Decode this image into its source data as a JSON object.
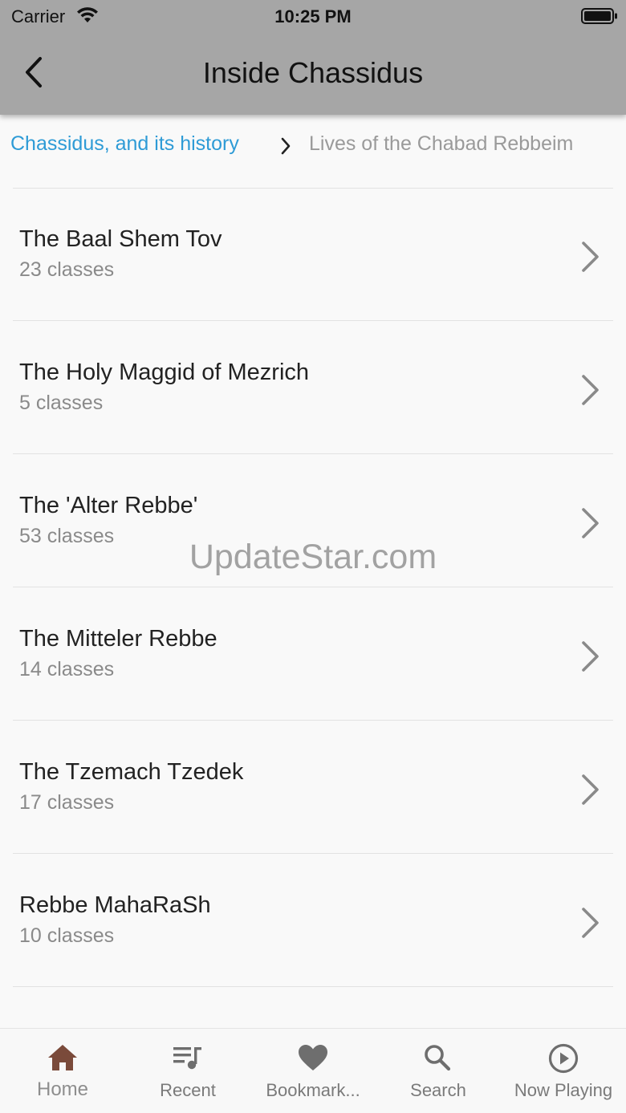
{
  "status_bar": {
    "carrier": "Carrier",
    "time": "10:25 PM"
  },
  "app_bar": {
    "title": "Inside Chassidus",
    "back_icon": "chevron-left-icon"
  },
  "breadcrumb": {
    "parent": "Chassidus, and its history",
    "separator_icon": "chevron-right-icon",
    "current": "Lives of the Chabad Rebbeim"
  },
  "list": {
    "items": [
      {
        "title": "The Baal Shem Tov",
        "count": "23 classes"
      },
      {
        "title": "The Holy Maggid of Mezrich",
        "count": "5 classes"
      },
      {
        "title": "The 'Alter Rebbe'",
        "count": "53 classes"
      },
      {
        "title": "The Mitteler Rebbe",
        "count": "14 classes"
      },
      {
        "title": "The Tzemach Tzedek",
        "count": "17 classes"
      },
      {
        "title": "Rebbe MahaRaSh",
        "count": "10 classes"
      }
    ]
  },
  "watermark": "UpdateStar.com",
  "tab_bar": {
    "active_color": "#7a4a3a",
    "tabs": [
      {
        "label": "Home",
        "icon": "home-icon",
        "active": true
      },
      {
        "label": "Recent",
        "icon": "playlist-icon",
        "active": false
      },
      {
        "label": "Bookmark...",
        "icon": "heart-icon",
        "active": false
      },
      {
        "label": "Search",
        "icon": "search-icon",
        "active": false
      },
      {
        "label": "Now Playing",
        "icon": "play-circle-icon",
        "active": false
      }
    ]
  }
}
